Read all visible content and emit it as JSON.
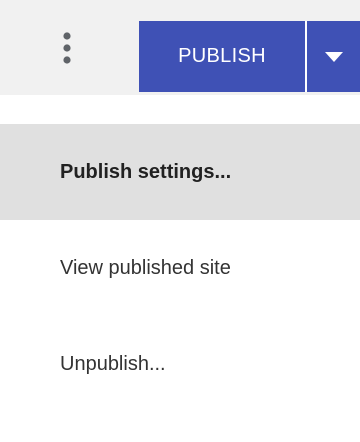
{
  "toolbar": {
    "more_icon": "more-vertical-icon",
    "publish_label": "PUBLISH",
    "dropdown_icon": "caret-down-icon",
    "colors": {
      "toolbar_bg": "#f1f1f1",
      "publish_bg": "#3f51b5",
      "publish_text": "#ffffff"
    }
  },
  "menu": {
    "items": [
      {
        "label": "Publish settings...",
        "active": true
      },
      {
        "label": "View published site",
        "active": false
      },
      {
        "label": "Unpublish...",
        "active": false
      }
    ],
    "colors": {
      "active_bg": "#e0e0e0",
      "menu_bg": "#ffffff"
    }
  }
}
